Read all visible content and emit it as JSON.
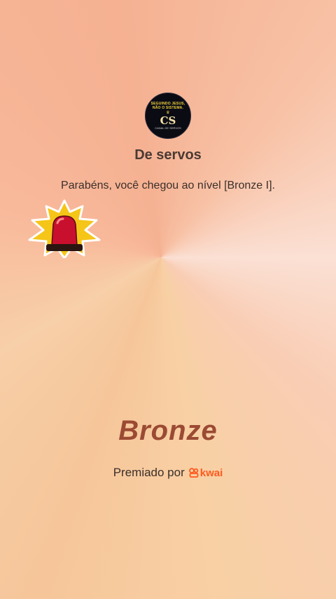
{
  "avatar": {
    "motto_line1": "SEGUINDO JESUS,",
    "motto_line2": "NÃO O SISTEMA.",
    "monogram": "CS",
    "caption": "CANAL DE SERVOS"
  },
  "profile_name": "De servos",
  "message": "Parabéns, você chegou ao nível [Bronze I].",
  "level_name": "Bronze",
  "awarded_by_label": "Premiado por",
  "brand_name": "kwai",
  "colors": {
    "brand": "#ff5a1f",
    "level_text": "#9b4a33",
    "siren_red": "#c8102e",
    "burst_yellow": "#f5c518"
  }
}
